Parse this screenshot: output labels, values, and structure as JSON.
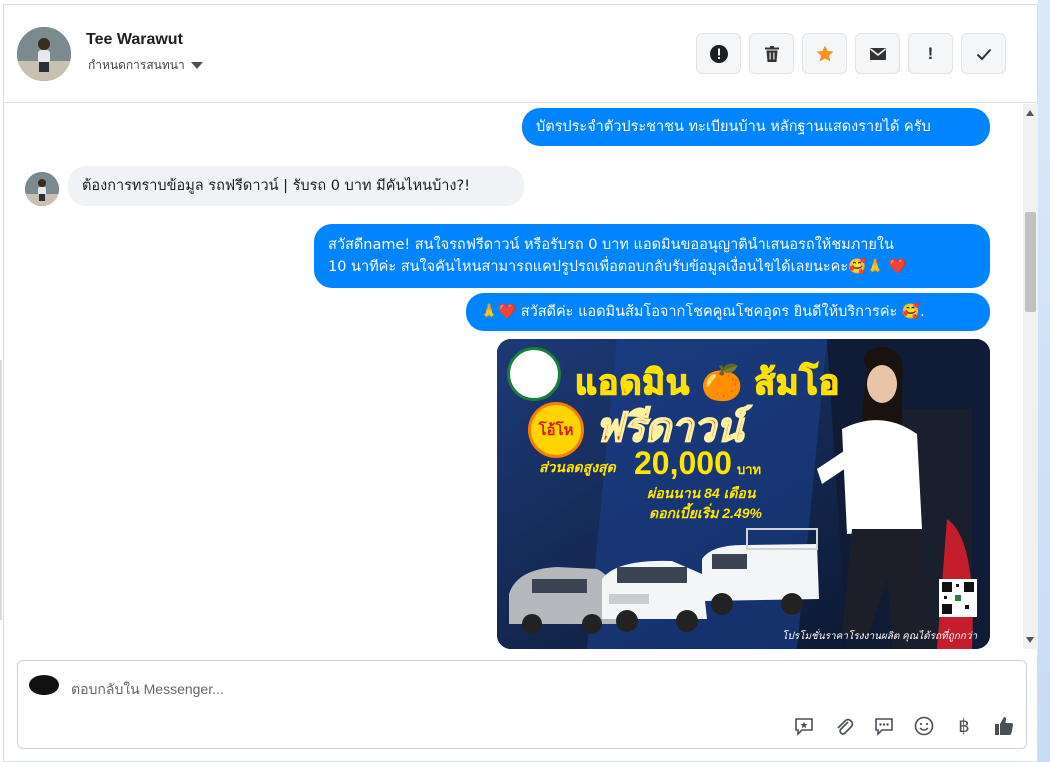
{
  "header": {
    "contact_name": "Tee Warawut",
    "subtitle": "กำหนดการสนทนา",
    "toolbar": {
      "spam_icon": "alert-circle-icon",
      "delete_icon": "trash-icon",
      "star_icon": "star-icon",
      "mail_icon": "envelope-icon",
      "important_label": "!",
      "done_icon": "check-icon"
    }
  },
  "messages": [
    {
      "direction": "out",
      "text": "บัตรประจำตัวประชาชน ทะเบียนบ้าน หลักฐานแสดงรายได้ ครับ"
    },
    {
      "direction": "in",
      "text": "ต้องการทราบข้อมูล รถฟรีดาวน์ | รับรถ 0 บาท มีคันไหนบ้าง?!"
    },
    {
      "direction": "out",
      "line1": "สวัสดีname! สนใจรถฟรีดาวน์ หรือรับรถ 0 บาท แอดมินขออนุญาตินำเสนอรถให้ชมภายใน",
      "line2": "10 นาทีค่ะ สนใจคันไหนสามารถแคปรูปรถเพื่อตอบกลับรับข้อมูลเงื่อนไขได้เลยนะคะ🥰🙏 ❤️"
    },
    {
      "direction": "out",
      "text": "🙏❤️ สวัสดีค่ะ แอดมินส้มโอจากโชคคูณโชคอุดร ยินดีให้บริการค่ะ 🥰."
    }
  ],
  "promo_image": {
    "title": "แอดมิน 🍊 ส้มโอ",
    "badge": "โอ้โห",
    "headline": "ฟรีดาวน์",
    "discount_label": "ส่วนลดสูงสุด",
    "discount_amount": "20,000",
    "currency": "บาท",
    "term": "ผ่อนนาน 84 เดือน",
    "rate": "ดอกเบี้ยเริ่ม 2.49%",
    "footer": "โปรโมชั่นราคาโรงงานผลิต คุณได้รถที่ถูกกว่า"
  },
  "composer": {
    "placeholder": "ตอบกลับใน Messenger...",
    "tools": [
      "saved-replies-icon",
      "attachment-icon",
      "message-template-icon",
      "emoji-icon",
      "baht-icon",
      "like-icon"
    ],
    "baht_glyph": "฿"
  },
  "colors": {
    "outgoing_bubble": "#0084ff",
    "incoming_bubble": "#f0f2f5",
    "star": "#f7931e"
  }
}
